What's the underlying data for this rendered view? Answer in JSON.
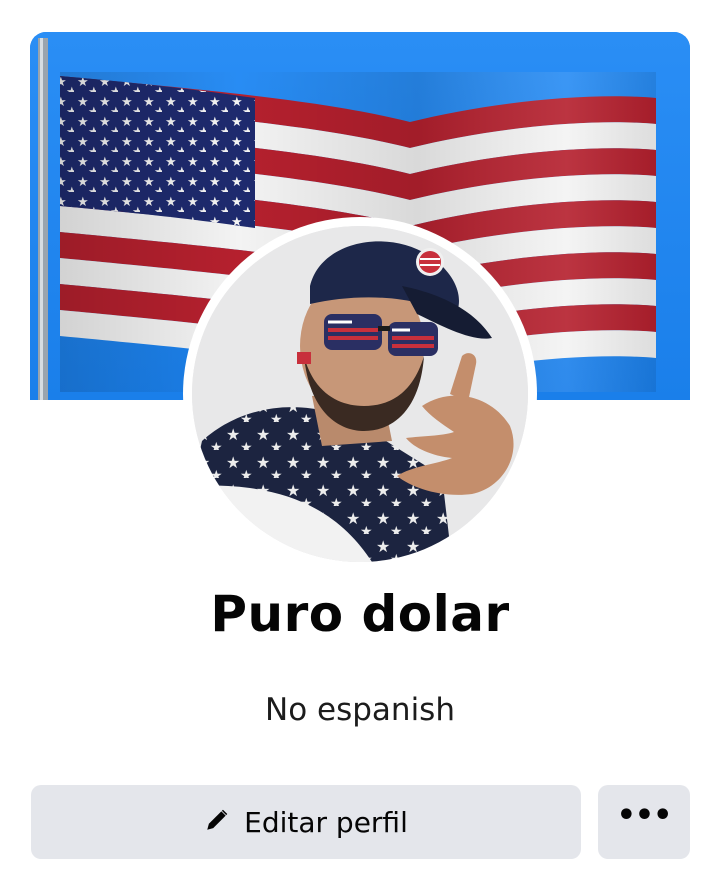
{
  "profile": {
    "name": "Puro dolar",
    "bio": "No espanish"
  },
  "actions": {
    "edit_label": "Editar perfil",
    "more_label": "•••"
  },
  "icons": {
    "edit": "pencil-icon",
    "more": "more-icon"
  },
  "colors": {
    "cover_sky": "#1f86f2",
    "button_bg": "#e4e6eb",
    "flag_red": "#b5202e",
    "flag_blue": "#1e2a6e",
    "text": "#050505"
  }
}
